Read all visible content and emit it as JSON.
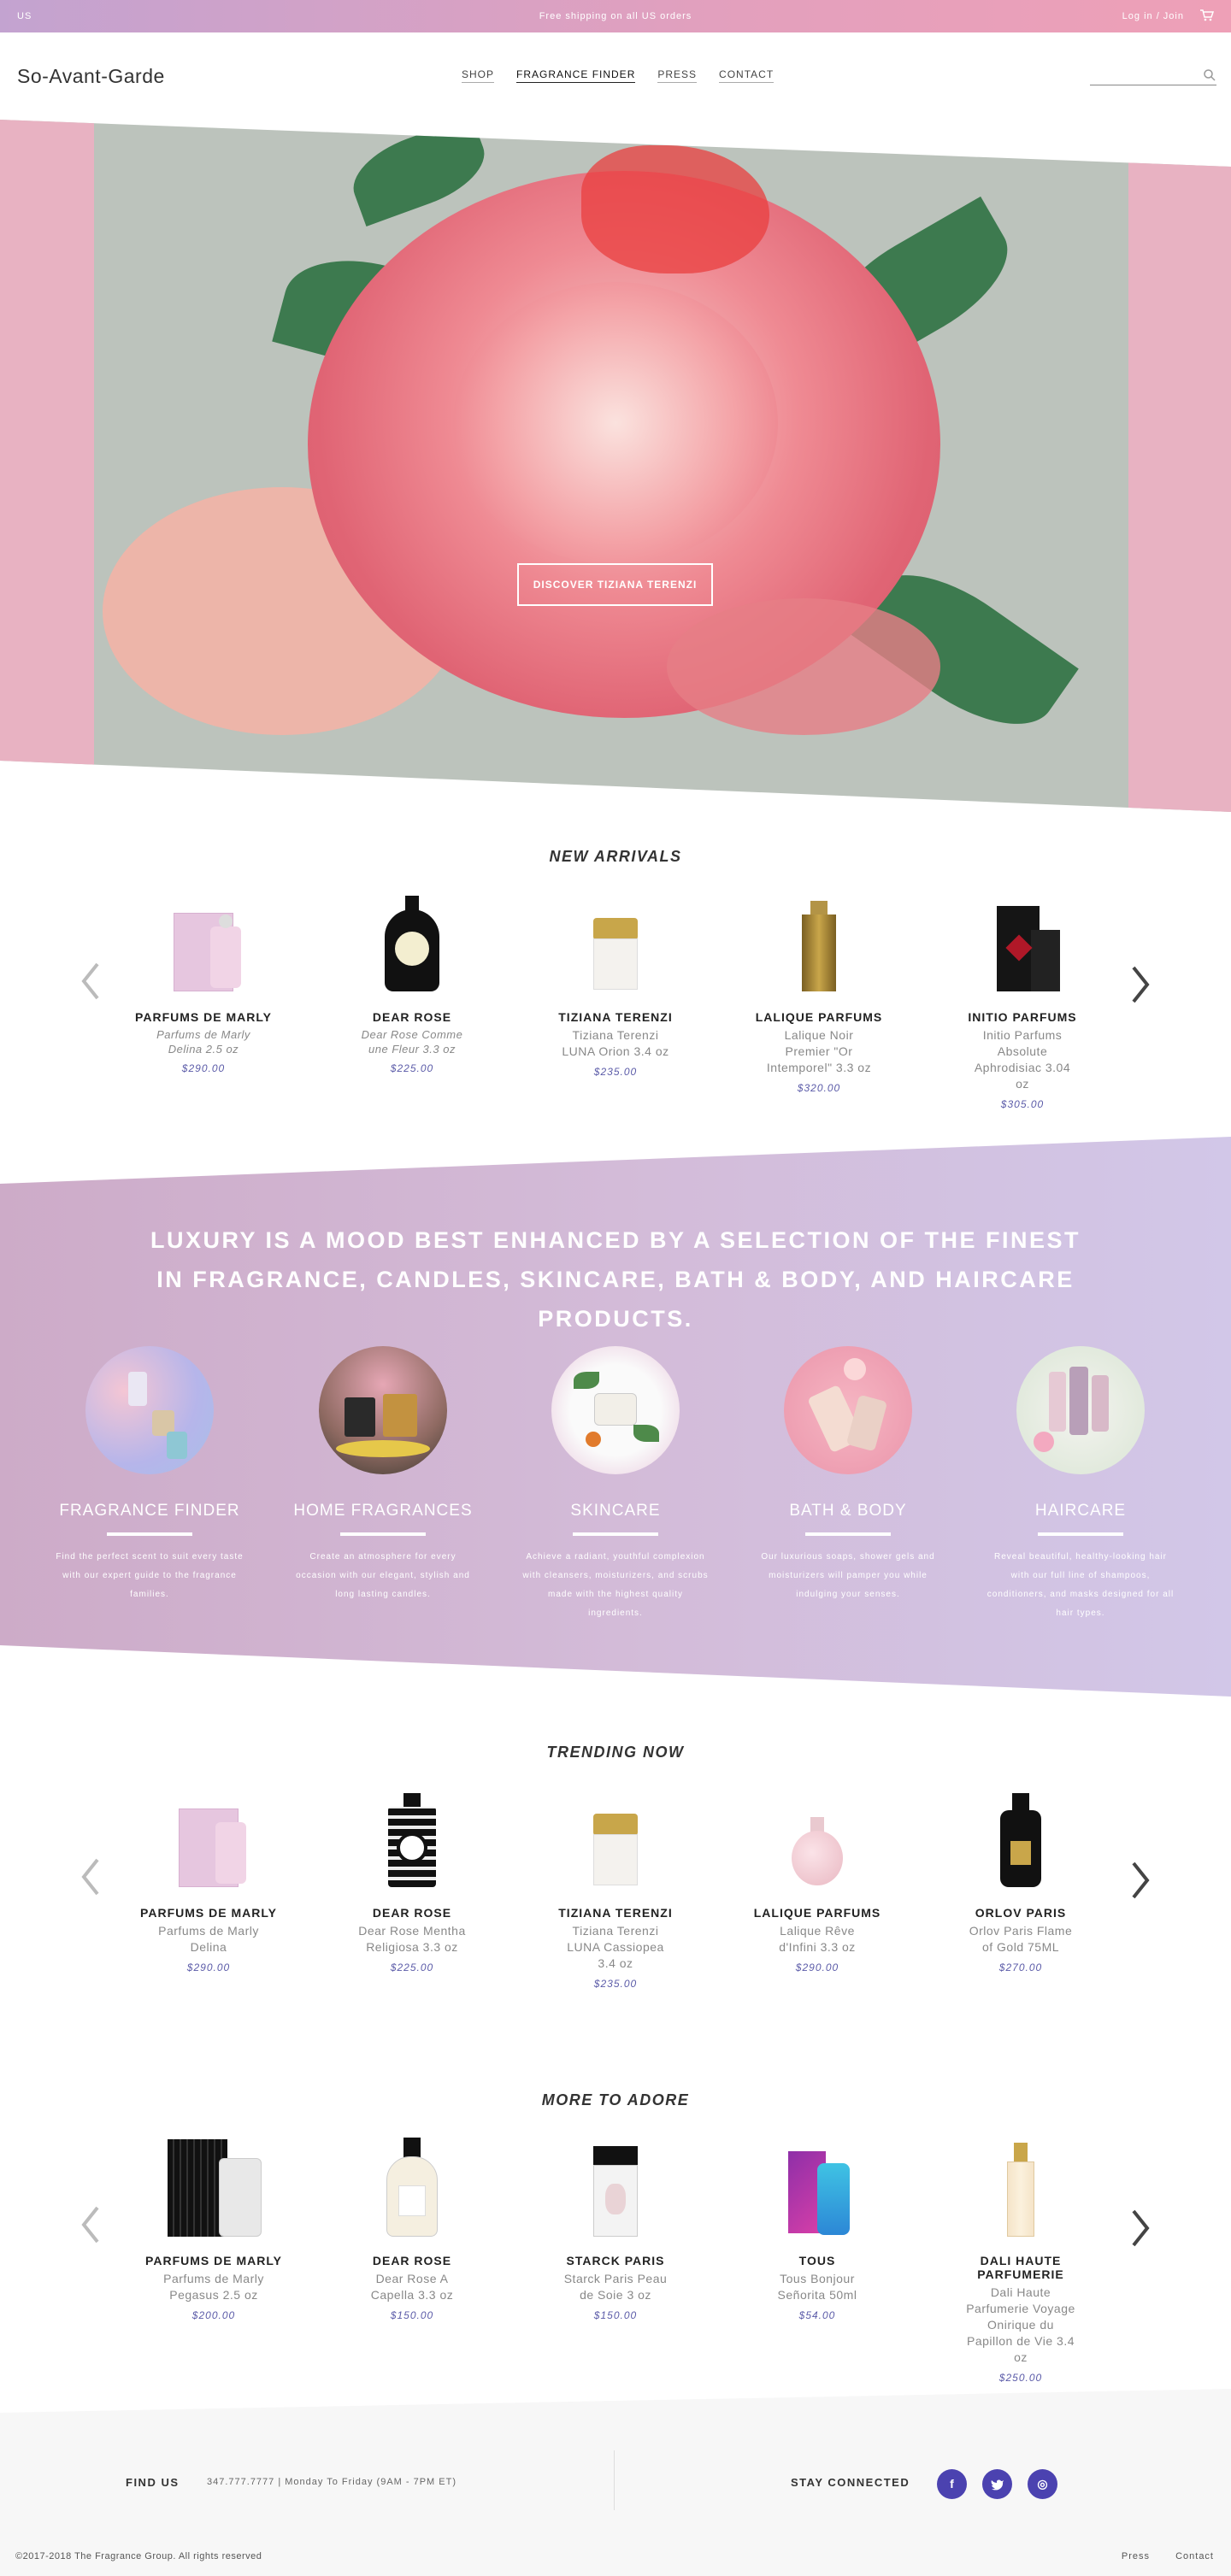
{
  "topbar": {
    "region": "US",
    "shipping": "Free shipping on all US orders",
    "login": "Log in / Join",
    "cart_icon": "cart-icon"
  },
  "header": {
    "logo": "So-Avant-Garde",
    "nav": [
      "SHOP",
      "FRAGRANCE FINDER",
      "PRESS",
      "CONTACT"
    ],
    "search_placeholder": "",
    "search_icon": "search-icon"
  },
  "hero": {
    "button": "DISCOVER TIZIANA TERENZI"
  },
  "new_arrivals": {
    "title": "NEW ARRIVALS",
    "items": [
      {
        "brand": "PARFUMS DE MARLY",
        "name": "Parfums de Marly Delina 2.5 oz",
        "price": "$290.00"
      },
      {
        "brand": "DEAR ROSE",
        "name": "Dear Rose Comme une Fleur 3.3 oz",
        "price": "$225.00"
      },
      {
        "brand": "TIZIANA TERENZI",
        "name": "Tiziana Terenzi LUNA Orion 3.4 oz",
        "price": "$235.00"
      },
      {
        "brand": "LALIQUE PARFUMS",
        "name": "Lalique Noir Premier \"Or Intemporel\" 3.3 oz",
        "price": "$320.00"
      },
      {
        "brand": "INITIO PARFUMS",
        "name": "Initio Parfums Absolute Aphrodisiac 3.04 oz",
        "price": "$305.00"
      }
    ]
  },
  "mood": {
    "headline": "LUXURY IS A MOOD BEST ENHANCED BY A SELECTION OF THE FINEST IN FRAGRANCE, CANDLES, SKINCARE, BATH & BODY, AND HAIRCARE PRODUCTS.",
    "categories": [
      {
        "title": "FRAGRANCE FINDER",
        "desc": "Find the perfect scent to suit every taste with our expert guide to the fragrance families."
      },
      {
        "title": "HOME FRAGRANCES",
        "desc": "Create an atmosphere for every occasion with our elegant, stylish and long lasting candles."
      },
      {
        "title": "SKINCARE",
        "desc": "Achieve a radiant, youthful complexion with cleansers, moisturizers, and scrubs made with the highest quality ingredients."
      },
      {
        "title": "BATH & BODY",
        "desc": "Our luxurious soaps, shower gels and moisturizers will pamper you while indulging your senses."
      },
      {
        "title": "HAIRCARE",
        "desc": "Reveal beautiful, healthy-looking hair with our full line of shampoos, conditioners, and masks designed for all hair types."
      }
    ]
  },
  "trending": {
    "title": "TRENDING NOW",
    "items": [
      {
        "brand": "PARFUMS DE MARLY",
        "name": "Parfums de Marly Delina",
        "price": "$290.00"
      },
      {
        "brand": "DEAR ROSE",
        "name": "Dear Rose Mentha Religiosa 3.3 oz",
        "price": "$225.00"
      },
      {
        "brand": "TIZIANA TERENZI",
        "name": "Tiziana Terenzi LUNA Cassiopea 3.4 oz",
        "price": "$235.00"
      },
      {
        "brand": "LALIQUE PARFUMS",
        "name": "Lalique Rêve d'Infini 3.3 oz",
        "price": "$290.00"
      },
      {
        "brand": "ORLOV PARIS",
        "name": "Orlov Paris Flame of Gold 75ML",
        "price": "$270.00"
      }
    ]
  },
  "adore": {
    "title": "MORE TO ADORE",
    "items": [
      {
        "brand": "PARFUMS DE MARLY",
        "name": "Parfums de Marly Pegasus 2.5 oz",
        "price": "$200.00"
      },
      {
        "brand": "DEAR ROSE",
        "name": "Dear Rose A Capella 3.3 oz",
        "price": "$150.00"
      },
      {
        "brand": "STARCK PARIS",
        "name": "Starck Paris Peau de Soie 3 oz",
        "price": "$150.00"
      },
      {
        "brand": "TOUS",
        "name": "Tous Bonjour Señorita 50ml",
        "price": "$54.00"
      },
      {
        "brand": "DALI HAUTE PARFUMERIE",
        "name": "Dali Haute Parfumerie Voyage Onirique du Papillon de Vie 3.4 oz",
        "price": "$250.00"
      }
    ]
  },
  "footer": {
    "find_us": "FIND US",
    "phone": "347.777.7777  |  Monday To Friday (9AM - 7PM ET)",
    "stay": "STAY CONNECTED",
    "social": [
      "f",
      "t",
      "◎"
    ],
    "copyright": "©2017-2018 The Fragrance Group. All rights reserved",
    "links": [
      "Press",
      "Contact"
    ]
  },
  "colors": {
    "accent": "#4b42b0",
    "price": "#5b5ba8",
    "topbar_start": "#c3a3d0",
    "topbar_end": "#eea0b7"
  }
}
